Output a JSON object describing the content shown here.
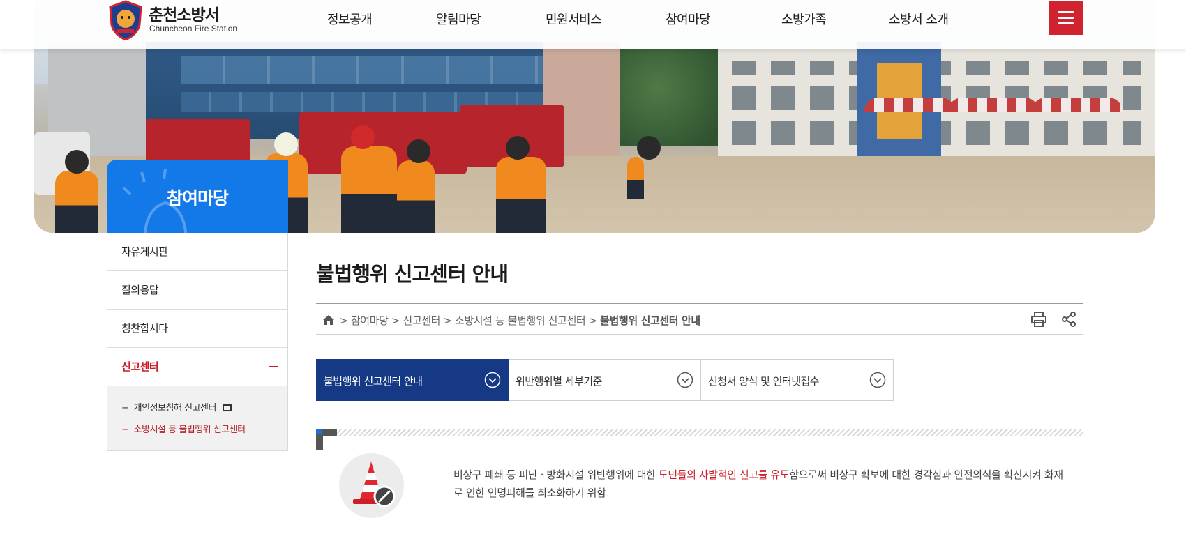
{
  "header": {
    "logo_name": "춘천소방서",
    "logo_sub": "Chuncheon Fire Station",
    "nav": [
      "정보공개",
      "알림마당",
      "민원서비스",
      "참여마당",
      "소방가족",
      "소방서 소개"
    ]
  },
  "sidebar": {
    "title": "참여마당",
    "items": [
      {
        "label": "자유게시판"
      },
      {
        "label": "질의응답"
      },
      {
        "label": "칭찬합시다"
      },
      {
        "label": "신고센터"
      }
    ],
    "subitems": [
      {
        "label": "개인정보침해 신고센터"
      },
      {
        "label": "소방시설 등 불법행위 신고센터"
      }
    ]
  },
  "page": {
    "title": "불법행위 신고센터 안내",
    "breadcrumb": [
      "참여마당",
      "신고센터",
      "소방시설 등 불법행위 신고센터",
      "불법행위 신고센터 안내"
    ]
  },
  "tabs": [
    {
      "label": "불법행위 신고센터 안내"
    },
    {
      "label": "위반행위별 세부기준"
    },
    {
      "label": "신청서 양식 및 인터넷접수"
    }
  ],
  "intro": {
    "before": "비상구 폐쇄 등 피난 · 방화시설 위반행위에 대한 ",
    "highlight": "도민들의 자발적인 신고를 유도",
    "after": "함으로써 비상구 확보에 대한 경각심과 안전의식을 확산시켜 화재로 인한 인명피해를 최소화하기 위함"
  },
  "colors": {
    "brand_red": "#d1222f",
    "sidebar_blue": "#1479e8",
    "tab_active": "#153984",
    "highlight_red": "#cc1e2a"
  },
  "icons": [
    "home-icon",
    "print-icon",
    "share-icon",
    "chevron-down-icon",
    "new-window-icon",
    "hamburger-icon",
    "traffic-cone-icon"
  ]
}
